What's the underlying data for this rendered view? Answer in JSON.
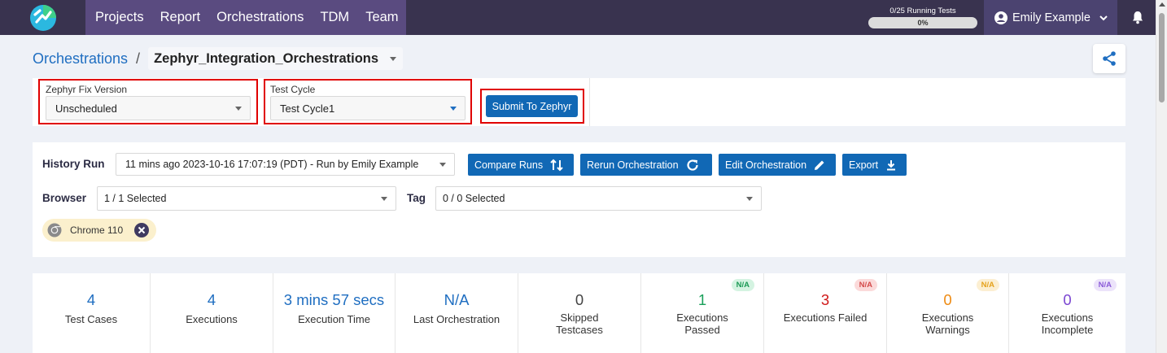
{
  "navbar": {
    "menu": [
      "Projects",
      "Report",
      "Orchestrations",
      "TDM",
      "Team"
    ],
    "running_label": "0/25 Running Tests",
    "running_pct_text": "0%",
    "running_progress": 0,
    "user_name": "Emily Example",
    "colors": {
      "bar": "#39334f",
      "menu": "#5a4b80",
      "user": "#4b4370"
    }
  },
  "breadcrumb": {
    "link": "Orchestrations",
    "separator": "/",
    "current": "Zephyr_Integration_Orchestrations"
  },
  "zephyr": {
    "fix_version_label": "Zephyr Fix Version",
    "fix_version_value": "Unscheduled",
    "test_cycle_label": "Test Cycle",
    "test_cycle_value": "Test Cycle1",
    "submit_label": "Submit To Zephyr"
  },
  "history": {
    "label": "History Run",
    "value": "11 mins ago 2023-10-16 17:07:19 (PDT) - Run by Emily Example",
    "buttons": {
      "compare": "Compare Runs",
      "rerun": "Rerun Orchestration",
      "edit": "Edit Orchestration",
      "export": "Export"
    },
    "browser_label": "Browser",
    "browser_value": "1 / 1 Selected",
    "tag_label": "Tag",
    "tag_value": "0 / 0 Selected",
    "chip_label": "Chrome 110"
  },
  "stats": [
    {
      "value": "4",
      "label": "Test Cases",
      "color": "#1f6ec1"
    },
    {
      "value": "4",
      "label": "Executions",
      "color": "#1f6ec1"
    },
    {
      "value": "3 mins 57 secs",
      "label": "Execution Time",
      "color": "#1f6ec1"
    },
    {
      "value": "N/A",
      "label": "Last Orchestration",
      "color": "#1f6ec1"
    },
    {
      "value": "0",
      "label": "Skipped Testcases",
      "color": "#444444"
    },
    {
      "value": "1",
      "label": "Executions Passed",
      "color": "#1aa05a",
      "badge": "N/A",
      "badge_bg": "#d4f3e1",
      "badge_fg": "#1a9954"
    },
    {
      "value": "3",
      "label": "Executions Failed",
      "color": "#d01818",
      "badge": "N/A",
      "badge_bg": "#fbdada",
      "badge_fg": "#d44a4a"
    },
    {
      "value": "0",
      "label": "Executions Warnings",
      "color": "#ee8a12",
      "badge": "N/A",
      "badge_bg": "#fcefd2",
      "badge_fg": "#e5a21c"
    },
    {
      "value": "0",
      "label": "Executions Incomplete",
      "color": "#7a45d1",
      "badge": "N/A",
      "badge_bg": "#ece3fa",
      "badge_fg": "#8a5ad8"
    }
  ]
}
